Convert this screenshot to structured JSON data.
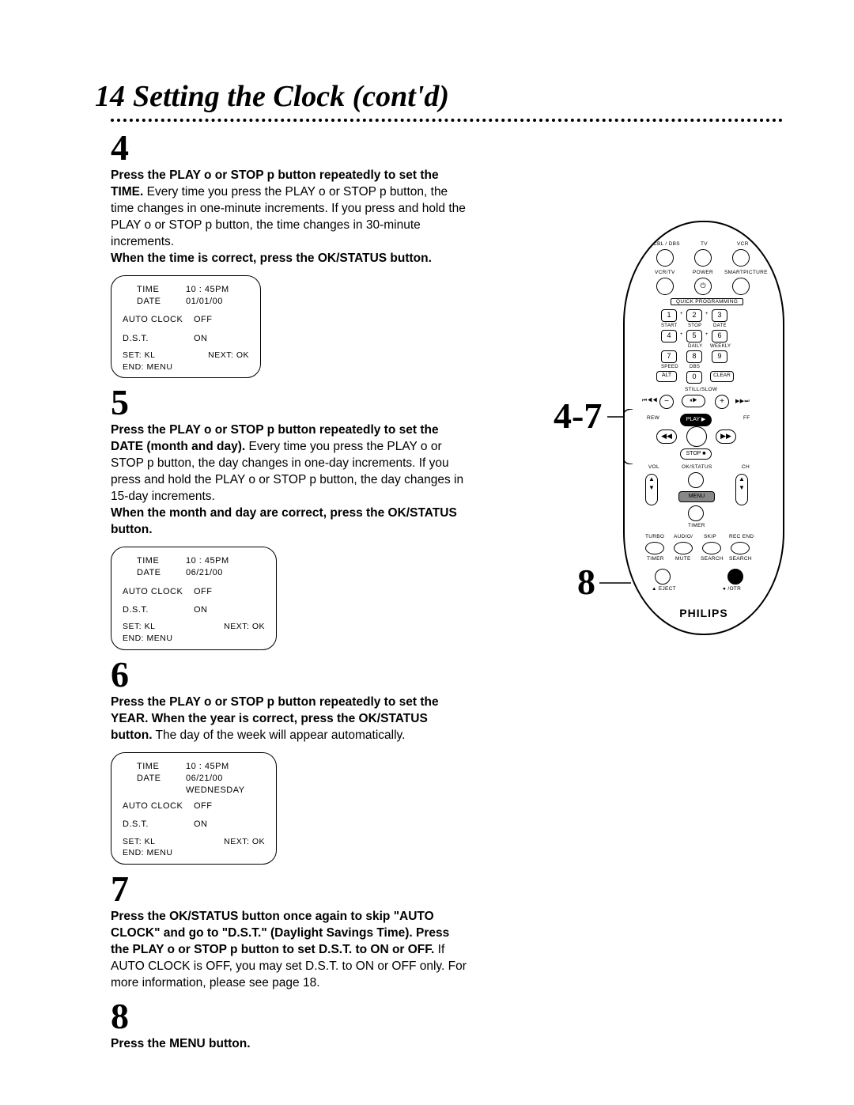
{
  "page_number": "14",
  "title": "Setting the Clock (cont'd)",
  "callouts": {
    "c47": "4-7",
    "c8": "8"
  },
  "steps": {
    "s4": {
      "num": "4",
      "para": "<b>Press the PLAY o or STOP p button repeatedly to set the TIME.</b> Every time you press the PLAY o or STOP p button, the time changes in one-minute increments. If you press and hold the PLAY o or STOP p button, the time changes in 30-minute increments.<br><b>When the time is correct, press the OK/STATUS button.</b>",
      "osd": {
        "time_l": "TIME",
        "time_v": "10 : 45PM",
        "date_l": "DATE",
        "date_v": "01/01/00",
        "day_v": "",
        "auto_l": "AUTO CLOCK",
        "auto_v": "OFF",
        "dst_l": "D.S.T.",
        "dst_v": "ON",
        "set": "SET: KL",
        "next": "NEXT: OK",
        "end": "END: MENU"
      }
    },
    "s5": {
      "num": "5",
      "para": "<b>Press the PLAY o or STOP p button repeatedly to set the DATE (month and day).</b> Every time you press the PLAY o or STOP p button, the day changes in one-day increments. If you press and hold the PLAY o or STOP p button, the day changes in 15-day increments.<br><b>When the month and day are correct, press the OK/STATUS button.</b>",
      "osd": {
        "time_l": "TIME",
        "time_v": "10 : 45PM",
        "date_l": "DATE",
        "date_v": "06/21/00",
        "day_v": "",
        "auto_l": "AUTO CLOCK",
        "auto_v": "OFF",
        "dst_l": "D.S.T.",
        "dst_v": "ON",
        "set": "SET: KL",
        "next": "NEXT: OK",
        "end": "END: MENU"
      }
    },
    "s6": {
      "num": "6",
      "para": "<b>Press the PLAY o or STOP p button repeatedly to set the YEAR. When the year is correct, press the OK/STATUS button.</b> The day of the week will appear automatically.",
      "osd": {
        "time_l": "TIME",
        "time_v": "10 : 45PM",
        "date_l": "DATE",
        "date_v": "06/21/00",
        "day_v": "WEDNESDAY",
        "auto_l": "AUTO CLOCK",
        "auto_v": "OFF",
        "dst_l": "D.S.T.",
        "dst_v": "ON",
        "set": "SET: KL",
        "next": "NEXT: OK",
        "end": "END: MENU"
      }
    },
    "s7": {
      "num": "7",
      "para": "<b>Press the OK/STATUS button once again to skip \"AUTO CLOCK\" and go to \"D.S.T.\" (Daylight Savings Time). Press the PLAY o or STOP p button to set D.S.T. to ON or OFF.</b> If AUTO CLOCK is OFF, you may set D.S.T. to ON or OFF only. For more information, please see page 18."
    },
    "s8": {
      "num": "8",
      "para": "<b>Press the MENU button.</b>"
    }
  },
  "remote": {
    "row1": {
      "a": "CBL / DBS",
      "b": "TV",
      "c": "VCR"
    },
    "row2": {
      "a": "VCR/TV",
      "b": "POWER",
      "c": "SMARTPICTURE"
    },
    "qp": "QUICK PROGRAMMING",
    "keys": [
      "1",
      "2",
      "3",
      "4",
      "5",
      "6",
      "7",
      "8",
      "9",
      "0"
    ],
    "key_sub": {
      "start": "START",
      "stop": "STOP",
      "date": "DATE",
      "daily": "DAILY",
      "weekly": "WEEKLY",
      "speed": "SPEED",
      "dbs": "DBS",
      "alt": "ALT",
      "clear": "CLEAR"
    },
    "stillslow": "STILL/SLOW",
    "transport": {
      "rew": "REW",
      "play": "PLAY ▶",
      "ff": "FF",
      "stop": "STOP ■"
    },
    "rocker": {
      "vol": "VOL",
      "ch": "CH",
      "ok": "OK/STATUS",
      "menu": "MENU",
      "timer": "TIMER"
    },
    "row_bot": {
      "turbo": "TURBO",
      "audio": "AUDIO/",
      "skip": "SKIP",
      "recend": "REC END",
      "timer": "TIMER",
      "mute": "MUTE",
      "search": "SEARCH",
      "search2": "SEARCH"
    },
    "eject": "▲ EJECT",
    "otr": "● /OTR",
    "brand": "PHILIPS",
    "minus": "−",
    "plus": "+",
    "plus_small": "+"
  }
}
